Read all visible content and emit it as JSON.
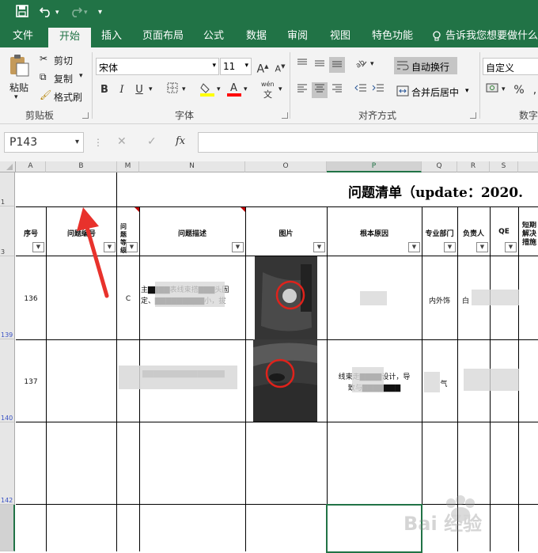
{
  "quick_access": {
    "save_icon": "save-icon",
    "undo_icon": "undo-icon",
    "redo_icon": "redo-icon",
    "more_icon": "customize-qat-icon"
  },
  "tabs": [
    "文件",
    "开始",
    "插入",
    "页面布局",
    "公式",
    "数据",
    "审阅",
    "视图",
    "特色功能"
  ],
  "active_tab": "开始",
  "tell_me": "告诉我您想要做什么...",
  "clipboard": {
    "paste": "粘贴",
    "cut": "剪切",
    "copy": "复制",
    "format_painter": "格式刷",
    "label": "剪贴板"
  },
  "font": {
    "name": "宋体",
    "size": "11",
    "grow": "A",
    "shrink": "A",
    "bold": "B",
    "italic": "I",
    "underline": "U",
    "wen": "wén",
    "wen_char": "文",
    "label": "字体"
  },
  "alignment": {
    "wrap_text": "自动换行",
    "merge_center": "合并后居中",
    "label": "对齐方式"
  },
  "number": {
    "format": "自定义",
    "percent": "%",
    "label": "数字"
  },
  "formula_bar": {
    "name_box": "P143",
    "cancel": "✕",
    "enter": "✓",
    "fx": "fx",
    "content": ""
  },
  "columns": [
    "A",
    "B",
    "M",
    "N",
    "O",
    "P",
    "Q",
    "R",
    "S"
  ],
  "rows": [
    "1",
    "3",
    "139",
    "140",
    "142"
  ],
  "sheet": {
    "title": "问题清单（update：2020.",
    "headers": [
      "序号",
      "问题编号",
      "问题等级",
      "问题描述",
      "图片",
      "根本原因",
      "专业部门",
      "负责人",
      "QE",
      "短期解决措施"
    ],
    "row136": {
      "no": "136",
      "level": "C",
      "desc_line1": "主▇▇▇▇表线束搭▇▇▇头固",
      "desc_line2": "定、▇▇▇▇▇▇▇▇▇小，拔",
      "dept": "内外饰",
      "owner": "白"
    },
    "row137": {
      "no": "137",
      "desc": "▇▇▇▇▇▇▇▇▇▇▇▇▇▇▇",
      "cause_line1": "线束走▇▇▇▇设计，导",
      "cause_line2": "致与▇▇▇▇▇▇▇",
      "dept": "气"
    }
  },
  "watermark": "Bai 经验",
  "colors": {
    "excel_green": "#217346",
    "ribbon_bg": "#f3f3f3",
    "annotation_red": "#e8322c"
  }
}
